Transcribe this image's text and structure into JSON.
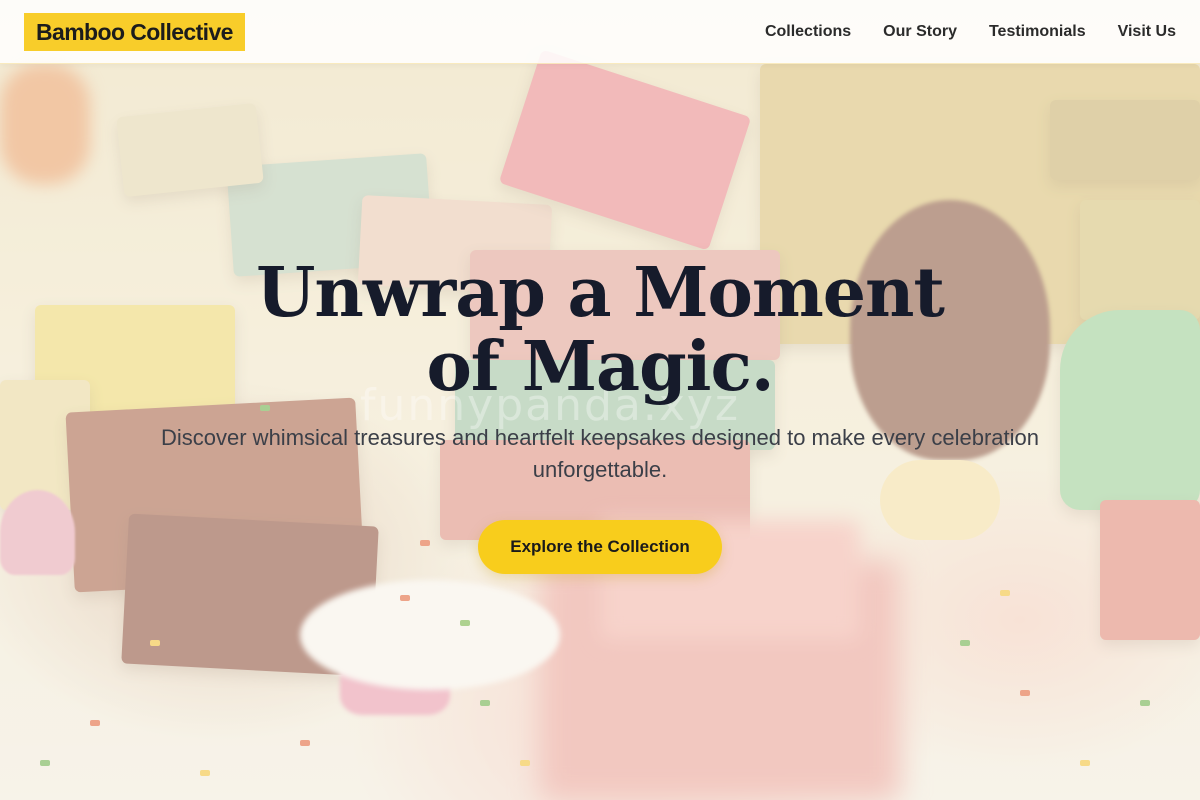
{
  "header": {
    "logo_text": "Bamboo Collective",
    "nav": [
      "Collections",
      "Our Story",
      "Testimonials",
      "Visit Us"
    ]
  },
  "hero": {
    "headline": "Unwrap a Moment of Magic.",
    "subline": "Discover whimsical treasures and heartfelt keepsakes designed to make every celebration unforgettable.",
    "cta_label": "Explore the Collection",
    "background_image": "soaps-and-pinecone-photo"
  },
  "colors": {
    "accent": "#f8cd1c",
    "headline": "#161b2b",
    "body_text": "#3b3f48"
  }
}
